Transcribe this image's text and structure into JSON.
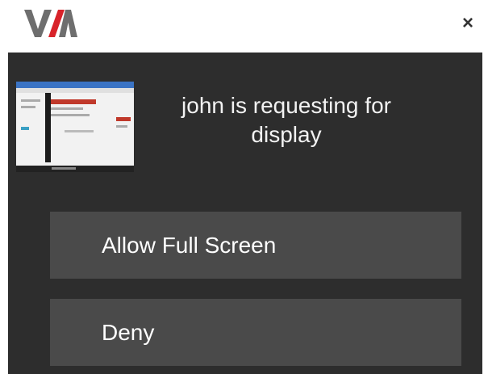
{
  "header": {
    "logo_icon": "via-logo",
    "close_icon": "close-icon",
    "close_glyph": "×"
  },
  "request": {
    "thumbnail_icon": "screen-share-thumbnail",
    "message": "john is requesting for display"
  },
  "actions": {
    "allow_label": "Allow Full Screen",
    "deny_label": "Deny"
  },
  "colors": {
    "panel_bg": "#2d2d2d",
    "button_bg": "#4a4a4a",
    "logo_gray": "#6e6e6e",
    "logo_red": "#d8232a"
  }
}
